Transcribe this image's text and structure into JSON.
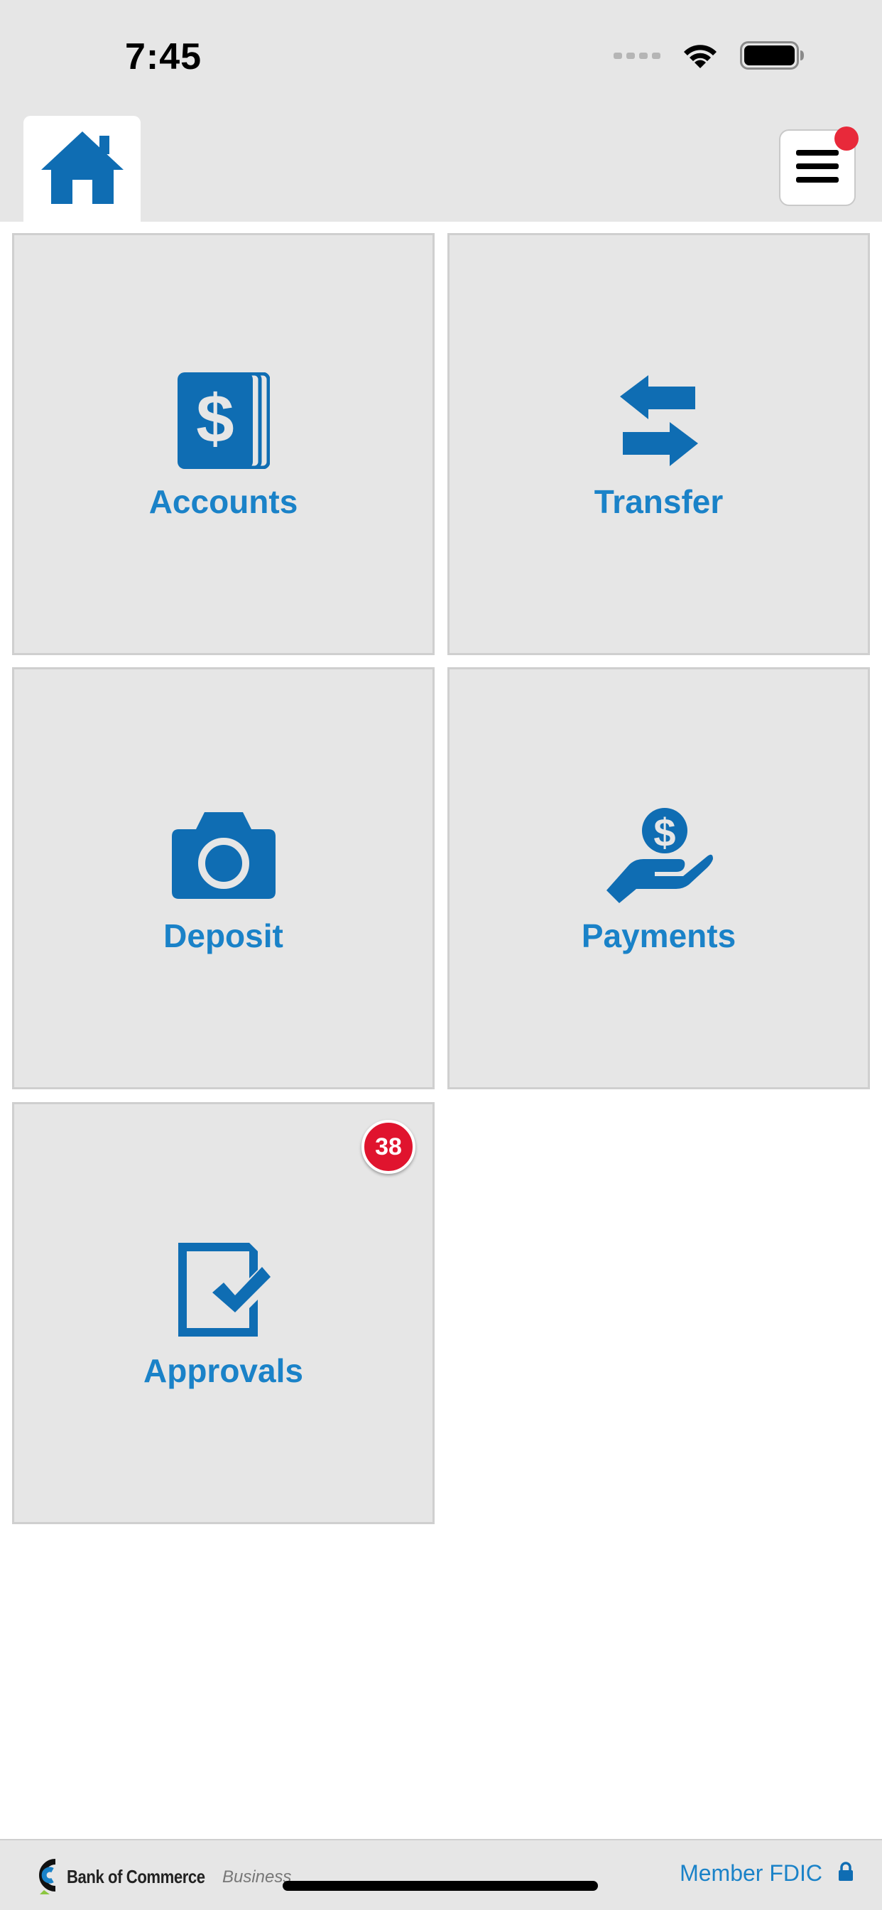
{
  "status": {
    "time": "7:45"
  },
  "tiles": {
    "accounts": {
      "label": "Accounts"
    },
    "transfer": {
      "label": "Transfer"
    },
    "deposit": {
      "label": "Deposit"
    },
    "payments": {
      "label": "Payments"
    },
    "approvals": {
      "label": "Approvals",
      "badge": "38"
    }
  },
  "footer": {
    "bank_name": "Bank of Commerce",
    "bank_sub": "Business",
    "fdic": "Member FDIC"
  },
  "colors": {
    "accent": "#1a82c8",
    "icon": "#0f6db3",
    "badge": "#e0142e",
    "tile_bg": "#e6e6e6"
  }
}
